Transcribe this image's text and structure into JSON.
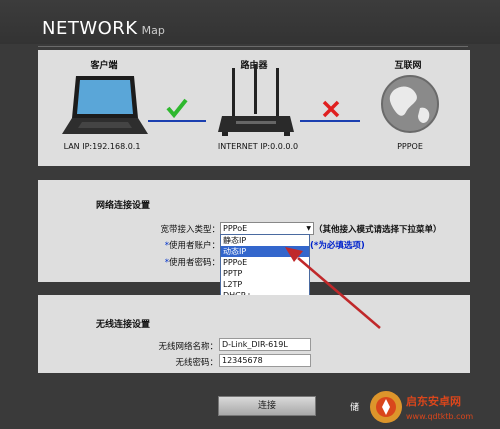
{
  "header": {
    "title_big": "NETWORK",
    "title_small": "Map"
  },
  "map": {
    "client_title": "客户端",
    "router_title": "路由器",
    "internet_title": "互联网",
    "lan_ip": "LAN IP:192.168.0.1",
    "internet_ip": "INTERNET IP:0.0.0.0",
    "internet_type": "PPPOE",
    "colors": {
      "ok": "#2eb82e",
      "fail": "#e02020",
      "link": "#1a3fb0"
    }
  },
  "network": {
    "title": "网络连接设置",
    "type_label": "宽带接入类型：",
    "type_value": "PPPoE",
    "type_hint": "（其他接入模式请选择下拉菜单）",
    "user_label": "使用者账户：",
    "pass_label": "使用者密码：",
    "required_hint": "(*为必填选项)",
    "options": [
      "静态IP",
      "动态IP",
      "PPPoE",
      "PPTP",
      "L2TP",
      "DHCP+"
    ],
    "highlighted_index": 1
  },
  "wireless": {
    "title": "无线连接设置",
    "ssid_label": "无线网络名称：",
    "ssid_value": "D-Link_DIR-619L",
    "pass_label": "无线密码：",
    "pass_value": "12345678"
  },
  "actions": {
    "connect_label": "连接",
    "save_label": "储"
  },
  "watermark": {
    "name": "启东安卓网",
    "url": "www.qdtktb.com"
  }
}
